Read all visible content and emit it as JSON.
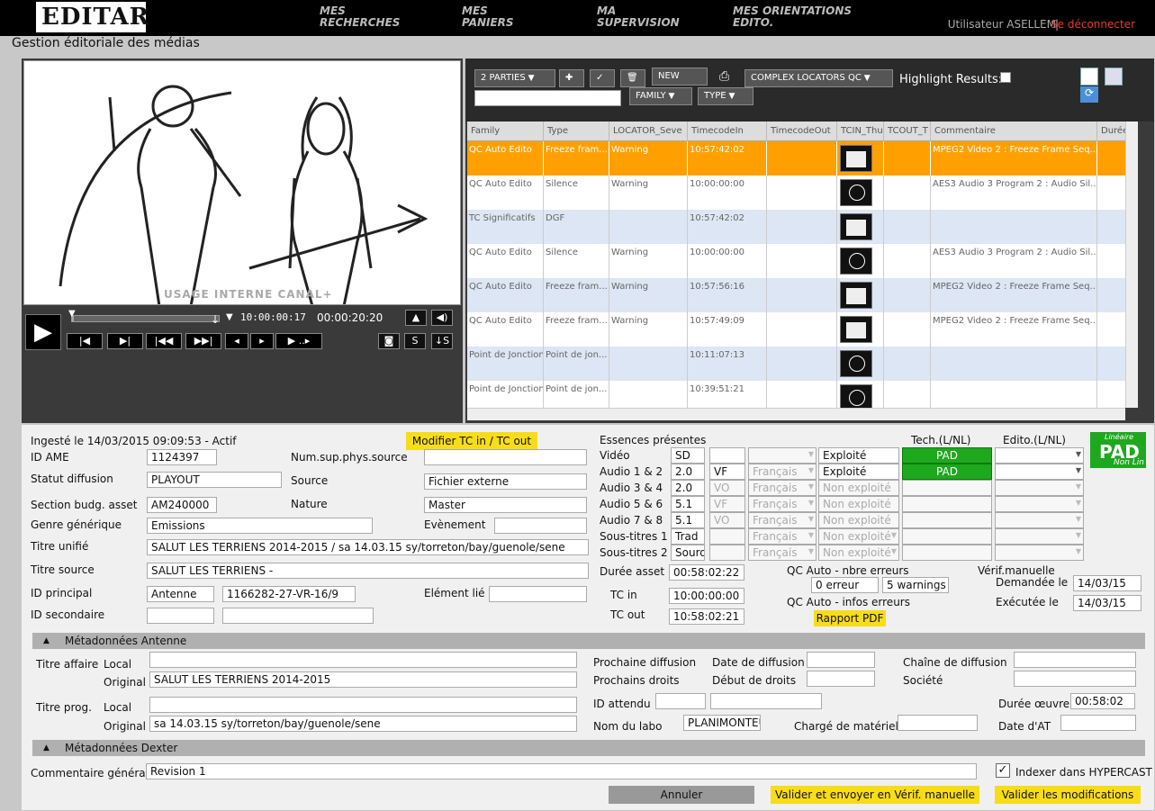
{
  "header": {
    "logo": "EDITAR",
    "nav": [
      "MES RECHERCHES",
      "MES PANIERS",
      "MA SUPERVISION",
      "MES ORIENTATIONS EDITO."
    ],
    "user_label": "Utilisateur ASELLEM",
    "logout": "Se déconnecter"
  },
  "page_title": "Gestion éditoriale des médias",
  "player": {
    "watermark": "USAGE INTERNE CANAL+",
    "timecode_current": "10:00:00:17",
    "timecode_duration": "00:00:20:20",
    "progress_fraction": 0.01
  },
  "toolbar": {
    "parts": "2 PARTIES",
    "new_clip": "NEW CLIP",
    "locators": "COMPLEX LOCATORS QC",
    "highlight": "Highlight Results:",
    "family": "FAMILY",
    "type": "TYPE"
  },
  "grid": {
    "columns": [
      "Family",
      "Type",
      "LOCATOR_Seve",
      "TimecodeIn",
      "TimecodeOut",
      "TCIN_Thu",
      "TCOUT_T",
      "Commentaire",
      "Durée"
    ],
    "rows": [
      {
        "family": "QC Auto Edito",
        "type": "Freeze fram...",
        "severity": "Warning",
        "tcin": "10:57:42:02",
        "tcout": "",
        "thumb": "image",
        "comment": "MPEG2 Video 2 : Freeze Frame Seq...",
        "selected": true
      },
      {
        "family": "QC Auto Edito",
        "type": "Silence",
        "severity": "Warning",
        "tcin": "10:00:00:00",
        "tcout": "",
        "thumb": "clock",
        "comment": "AES3 Audio 3 Program 2 : Audio Sil...",
        "selected": false
      },
      {
        "family": "TC Significatifs",
        "type": "DGF",
        "severity": "",
        "tcin": "10:57:42:02",
        "tcout": "",
        "thumb": "image",
        "comment": "",
        "selected": false
      },
      {
        "family": "QC Auto Edito",
        "type": "Silence",
        "severity": "Warning",
        "tcin": "10:00:00:00",
        "tcout": "",
        "thumb": "clock",
        "comment": "AES3 Audio 3 Program 2 : Audio Sil...",
        "selected": false
      },
      {
        "family": "QC Auto Edito",
        "type": "Freeze fram...",
        "severity": "Warning",
        "tcin": "10:57:56:16",
        "tcout": "",
        "thumb": "image",
        "comment": "MPEG2 Video 2 : Freeze Frame Seq...",
        "selected": false
      },
      {
        "family": "QC Auto Edito",
        "type": "Freeze fram...",
        "severity": "Warning",
        "tcin": "10:57:49:09",
        "tcout": "",
        "thumb": "image",
        "comment": "MPEG2 Video 2 : Freeze Frame Seq...",
        "selected": false
      },
      {
        "family": "Point de Jonction",
        "type": "Point de jon...",
        "severity": "",
        "tcin": "10:11:07:13",
        "tcout": "",
        "thumb": "clock",
        "comment": "",
        "selected": false
      },
      {
        "family": "Point de Jonction",
        "type": "Point de jon...",
        "severity": "",
        "tcin": "10:39:51:21",
        "tcout": "",
        "thumb": "clock",
        "comment": "",
        "selected": false
      }
    ]
  },
  "form": {
    "ingest": "Ingesté le 14/03/2015 09:09:53 - Actif",
    "modify_tc": "Modifier TC in / TC out",
    "id_ame_label": "ID AME",
    "id_ame": "1124397",
    "num_sup_label": "Num.sup.phys.source",
    "num_sup": "",
    "statut_label": "Statut diffusion",
    "statut": "PLAYOUT",
    "source_label": "Source",
    "source": "Fichier externe",
    "section_label": "Section budg. asset",
    "section": "AM240000",
    "nature_label": "Nature",
    "nature": "Master",
    "genre_label": "Genre générique",
    "genre": "Emissions",
    "evenement_label": "Evènement",
    "evenement": "",
    "titre_unifie_label": "Titre unifié",
    "titre_unifie": "SALUT LES TERRIENS 2014-2015 / sa 14.03.15 sy/torreton/bay/guenole/sene",
    "titre_source_label": "Titre source",
    "titre_source": "SALUT LES TERRIENS -",
    "id_principal_label": "ID principal",
    "id_principal_type": "Antenne",
    "id_principal": "1166282-27-VR-16/9",
    "element_lie_label": "Elément lié",
    "element_lie": "",
    "id_secondaire_label": "ID secondaire",
    "essences_label": "Essences présentes",
    "tech_label": "Tech.(L/NL)",
    "edito_label": "Edito.(L/NL)",
    "essences": [
      {
        "label": "Vidéo",
        "v1": "SD",
        "v2": "",
        "v3": "",
        "status": "Exploité",
        "tech": "PAD",
        "active": true
      },
      {
        "label": "Audio 1 & 2",
        "v1": "2.0",
        "v2": "VF",
        "v3": "Français",
        "status": "Exploité",
        "tech": "PAD",
        "active": true
      },
      {
        "label": "Audio 3 & 4",
        "v1": "2.0",
        "v2": "VO",
        "v3": "Français",
        "status": "Non exploité",
        "tech": "",
        "active": false
      },
      {
        "label": "Audio 5 & 6",
        "v1": "5.1",
        "v2": "VF",
        "v3": "Français",
        "status": "Non exploité",
        "tech": "",
        "active": false
      },
      {
        "label": "Audio 7 & 8",
        "v1": "5.1",
        "v2": "VO",
        "v3": "Français",
        "status": "Non exploité",
        "tech": "",
        "active": false
      },
      {
        "label": "Sous-titres 1",
        "v1": "Trad",
        "v2": "",
        "v3": "Français",
        "status": "Non exploité",
        "tech": "",
        "active": false
      },
      {
        "label": "Sous-titres 2",
        "v1": "Sourd",
        "v2": "",
        "v3": "Français",
        "status": "Non exploité",
        "tech": "",
        "active": false
      }
    ],
    "pad_badge": {
      "top": "Linéaire",
      "main": "PAD",
      "bottom": "Non Lin"
    },
    "duree_asset_label": "Durée asset",
    "duree_asset": "00:58:02:22",
    "tc_in_label": "TC in",
    "tc_in": "10:00:00:00",
    "tc_out_label": "TC out",
    "tc_out": "10:58:02:21",
    "qc_nbre_label": "QC Auto - nbre erreurs",
    "qc_erreurs": "0 erreur",
    "qc_warnings": "5 warnings",
    "qc_infos_label": "QC Auto - infos erreurs",
    "rapport": "Rapport PDF",
    "verif_label": "Vérif.manuelle",
    "demandee_label": "Demandée le",
    "demandee": "14/03/15",
    "executee_label": "Exécutée le",
    "executee": "14/03/15"
  },
  "meta_antenne": {
    "header": "Métadonnées Antenne",
    "titre_affaire_label": "Titre affaire",
    "local_label": "Local",
    "original_label": "Original",
    "titre_affaire_local": "",
    "titre_affaire_original": "SALUT LES TERRIENS 2014-2015",
    "titre_prog_label": "Titre prog.",
    "titre_prog_local": "",
    "titre_prog_original": "sa 14.03.15 sy/torreton/bay/guenole/sene",
    "prochaine_diff_label": "Prochaine diffusion",
    "date_diff_label": "Date de diffusion",
    "date_diff": "",
    "chaine_label": "Chaîne de diffusion",
    "chaine": "",
    "prochains_droits_label": "Prochains droits",
    "debut_droits_label": "Début de droits",
    "debut_droits": "",
    "societe_label": "Société",
    "societe": "",
    "id_attendu_label": "ID attendu",
    "duree_oeuvre_label": "Durée œuvre",
    "duree_oeuvre": "00:58:02",
    "labo_label": "Nom du labo",
    "labo": "PLANIMONTEU",
    "charge_label": "Chargé de matériel",
    "charge": "",
    "date_at_label": "Date d'AT",
    "date_at": ""
  },
  "meta_dexter": {
    "header": "Métadonnées Dexter"
  },
  "footer": {
    "commentaire_label": "Commentaire général",
    "commentaire": "Revision 1",
    "indexer_label": "Indexer dans HYPERCAST",
    "annuler": "Annuler",
    "valider_envoyer": "Valider et envoyer en Vérif. manuelle",
    "valider": "Valider les modifications"
  }
}
